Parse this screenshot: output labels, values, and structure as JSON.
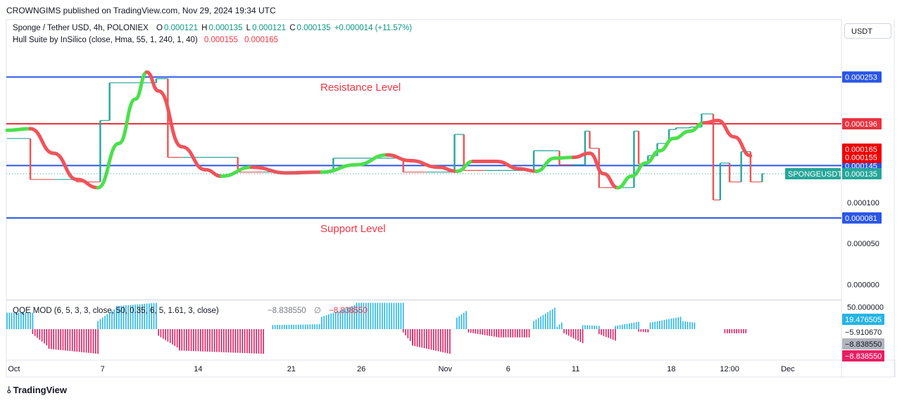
{
  "header": {
    "published": "CROWNGIMS published on TradingView.com, Nov 29, 2024 19:34 UTC"
  },
  "legend": {
    "symbol": "Sponge / Tether USD, 4h, POLONIEX",
    "o_label": "O",
    "o_value": "0.000121",
    "h_label": "H",
    "h_value": "0.000135",
    "l_label": "L",
    "l_value": "0.000121",
    "c_label": "C",
    "c_value": "0.000135",
    "change": "+0.000014 (+11.57%)",
    "hull_name": "Hull Suite by InSilico (close, Hma, 55, 1, 240, 1, 40)",
    "hull_v1": "0.000155",
    "hull_v2": "0.000165",
    "qqe_name": "QQE MOD (6, 5, 3, 3, close, 50, 0.35, 6, 5, 1.61, 3, close)",
    "qqe_v1": "−8.838550",
    "qqe_sym": "∅",
    "qqe_v2": "−8.838550"
  },
  "currency_button": "USDT",
  "annotations": {
    "resistance": "Resistance Level",
    "support": "Support Level"
  },
  "footer": {
    "brand": "TradingView"
  },
  "colors": {
    "bull_candle": "#26a69a",
    "bear_candle": "#ef5350",
    "hull_up": "#4ce04c",
    "hull_down": "#f0535a",
    "level_blue": "#2a56e6",
    "level_red": "#e8333f",
    "qqe_blue": "#26b4e6",
    "qqe_pink": "#d81b60"
  },
  "chart_data": [
    {
      "type": "candlestick",
      "title": "Sponge / Tether USD, 4h, POLONIEX",
      "x_ticks": [
        "Oct",
        "7",
        "14",
        "21",
        "26",
        "Nov",
        "6",
        "11",
        "18",
        "12:00",
        "Dec"
      ],
      "price_ticks": [
        "0.000100",
        "0.000050",
        "0.000000"
      ],
      "ylim": [
        -1e-05,
        0.000275
      ],
      "overlapped_tick_text": "0.000200",
      "last_price": "0.000135",
      "last_price_label": "SPONGEUSDT",
      "levels": [
        {
          "name": "resistance",
          "value": 0.000253,
          "label": "0.000253",
          "color": "#2a56e6"
        },
        {
          "name": "red-level",
          "value": 0.000196,
          "label": "0.000196",
          "color": "#e8333f"
        },
        {
          "name": "mid-level",
          "value": 0.000145,
          "label": "0.000145",
          "color": "#2a56e6"
        },
        {
          "name": "support",
          "value": 8.1e-05,
          "label": "0.000081",
          "color": "#2a56e6"
        }
      ],
      "price_badges": [
        {
          "label": "0.000165",
          "value": 0.000165,
          "color": "#f00000"
        },
        {
          "label": "0.000155",
          "value": 0.000155,
          "color": "#f00000"
        }
      ],
      "candles": [
        {
          "t": 0.0,
          "o": 0.000178,
          "c": 0.000178
        },
        {
          "t": 1.0,
          "o": 0.000178,
          "c": 0.000128
        },
        {
          "t": 2.0,
          "o": 0.000128,
          "c": 0.000128
        },
        {
          "t": 3.0,
          "o": 0.000128,
          "c": 0.000125
        },
        {
          "t": 4.0,
          "o": 0.000125,
          "c": 0.0002
        },
        {
          "t": 4.4,
          "o": 0.0002,
          "c": 0.000246
        },
        {
          "t": 4.9,
          "o": 0.000246,
          "c": 0.000246
        },
        {
          "t": 5.6,
          "o": 0.000246,
          "c": 0.000246
        },
        {
          "t": 6.4,
          "o": 0.000246,
          "c": 0.000251
        },
        {
          "t": 6.9,
          "o": 0.000251,
          "c": 0.000155
        },
        {
          "t": 7.5,
          "o": 0.000155,
          "c": 0.000155
        },
        {
          "t": 8.5,
          "o": 0.000155,
          "c": 0.000155
        },
        {
          "t": 9.9,
          "o": 0.000155,
          "c": 0.000137
        },
        {
          "t": 11.0,
          "o": 0.000137,
          "c": 0.000137
        },
        {
          "t": 12.5,
          "o": 0.000137,
          "c": 0.000137
        },
        {
          "t": 13.6,
          "o": 0.000137,
          "c": 0.000137
        },
        {
          "t": 14.0,
          "o": 0.000137,
          "c": 0.000154
        },
        {
          "t": 15.5,
          "o": 0.000154,
          "c": 0.000154
        },
        {
          "t": 17.0,
          "o": 0.000154,
          "c": 0.000137
        },
        {
          "t": 18.0,
          "o": 0.000137,
          "c": 0.000137
        },
        {
          "t": 19.0,
          "o": 0.000137,
          "c": 0.000137
        },
        {
          "t": 19.2,
          "o": 0.000137,
          "c": 0.000183
        },
        {
          "t": 19.6,
          "o": 0.000183,
          "c": 0.000139
        },
        {
          "t": 20.5,
          "o": 0.000139,
          "c": 0.000139
        },
        {
          "t": 22.0,
          "o": 0.000139,
          "c": 0.000139
        },
        {
          "t": 22.6,
          "o": 0.000139,
          "c": 0.000163
        },
        {
          "t": 23.4,
          "o": 0.000163,
          "c": 0.000163
        },
        {
          "t": 23.7,
          "o": 0.000163,
          "c": 0.000146
        },
        {
          "t": 24.3,
          "o": 0.000146,
          "c": 0.000146
        },
        {
          "t": 24.8,
          "o": 0.000146,
          "c": 0.000187
        },
        {
          "t": 25.0,
          "o": 0.000187,
          "c": 0.000166
        },
        {
          "t": 25.4,
          "o": 0.000166,
          "c": 0.000118
        },
        {
          "t": 26.3,
          "o": 0.000118,
          "c": 0.000118
        },
        {
          "t": 26.9,
          "o": 0.000118,
          "c": 0.000187
        },
        {
          "t": 27.1,
          "o": 0.000187,
          "c": 0.000147
        },
        {
          "t": 27.5,
          "o": 0.000147,
          "c": 0.000157
        },
        {
          "t": 27.9,
          "o": 0.000157,
          "c": 0.000172
        },
        {
          "t": 28.4,
          "o": 0.000172,
          "c": 0.000189
        },
        {
          "t": 28.7,
          "o": 0.000189,
          "c": 0.000191
        },
        {
          "t": 29.3,
          "o": 0.000191,
          "c": 0.000192
        },
        {
          "t": 29.8,
          "o": 0.000192,
          "c": 0.000208
        },
        {
          "t": 30.1,
          "o": 0.000208,
          "c": 0.000208
        },
        {
          "t": 30.3,
          "o": 0.000208,
          "c": 0.000103
        },
        {
          "t": 30.6,
          "o": 0.000103,
          "c": 0.000148
        },
        {
          "t": 31.0,
          "o": 0.000148,
          "c": 0.000125
        },
        {
          "t": 31.5,
          "o": 0.000125,
          "c": 0.000162
        },
        {
          "t": 31.9,
          "o": 0.000162,
          "c": 0.000125
        },
        {
          "t": 32.4,
          "o": 0.000125,
          "c": 0.000135
        }
      ],
      "hull": [
        [
          0.0,
          0.000188,
          "up"
        ],
        [
          1.0,
          0.00019,
          "down"
        ],
        [
          2.0,
          0.00016,
          "down"
        ],
        [
          3.0,
          0.000128,
          "down"
        ],
        [
          3.9,
          0.000118,
          "up"
        ],
        [
          4.8,
          0.000172,
          "up"
        ],
        [
          5.5,
          0.000226,
          "up"
        ],
        [
          6.0,
          0.000259,
          "down"
        ],
        [
          6.5,
          0.000236,
          "down"
        ],
        [
          7.5,
          0.000168,
          "down"
        ],
        [
          8.5,
          0.00014,
          "down"
        ],
        [
          9.2,
          0.000132,
          "up"
        ],
        [
          10.5,
          0.000143,
          "down"
        ],
        [
          12.0,
          0.000136,
          "down"
        ],
        [
          13.5,
          0.000137,
          "up"
        ],
        [
          15.0,
          0.000146,
          "up"
        ],
        [
          16.3,
          0.000158,
          "down"
        ],
        [
          17.3,
          0.000151,
          "down"
        ],
        [
          18.5,
          0.000143,
          "down"
        ],
        [
          19.3,
          0.000138,
          "up"
        ],
        [
          20.0,
          0.00015,
          "down"
        ],
        [
          21.0,
          0.00015,
          "down"
        ],
        [
          22.0,
          0.000141,
          "down"
        ],
        [
          22.7,
          0.000138,
          "up"
        ],
        [
          23.5,
          0.000154,
          "up"
        ],
        [
          24.3,
          0.000155,
          "down"
        ],
        [
          25.0,
          0.00016,
          "down"
        ],
        [
          25.6,
          0.000135,
          "down"
        ],
        [
          26.2,
          0.000118,
          "up"
        ],
        [
          26.8,
          0.000132,
          "up"
        ],
        [
          27.4,
          0.000148,
          "up"
        ],
        [
          28.0,
          0.000163,
          "up"
        ],
        [
          28.6,
          0.000178,
          "up"
        ],
        [
          29.3,
          0.000187,
          "up"
        ],
        [
          29.9,
          0.000197,
          "down"
        ],
        [
          30.5,
          0.0002,
          "down"
        ],
        [
          31.2,
          0.00018,
          "down"
        ],
        [
          31.9,
          0.000157,
          "down"
        ]
      ]
    },
    {
      "type": "histogram",
      "title": "QQE MOD (6, 5, 3, 3, close, 50, 0.35, 6, 5, 1.61, 3, close)",
      "y_ticks": [
        "50.000000"
      ],
      "value_badges": [
        {
          "label": "19.476505",
          "color": "#26b4e6"
        },
        {
          "label": "−5.910670",
          "color": "#ffffff"
        },
        {
          "label": "−8.838550",
          "color": "#b2b5be"
        },
        {
          "label": "−8.838550",
          "color": "#e91e63"
        }
      ],
      "ylim": [
        -40,
        45
      ],
      "segments": [
        {
          "t0": 0.0,
          "t1": 1.1,
          "v0": 20,
          "v1": 20,
          "color": "blue"
        },
        {
          "t0": 1.1,
          "t1": 1.8,
          "v0": -6,
          "v1": -22,
          "color": "pink"
        },
        {
          "t0": 1.8,
          "t1": 3.9,
          "v0": -24,
          "v1": -30,
          "color": "pink"
        },
        {
          "t0": 3.9,
          "t1": 4.7,
          "v0": 10,
          "v1": 26,
          "color": "blue"
        },
        {
          "t0": 4.7,
          "t1": 6.4,
          "v0": 28,
          "v1": 32,
          "color": "blue"
        },
        {
          "t0": 6.5,
          "t1": 7.4,
          "v0": -8,
          "v1": -24,
          "color": "pink"
        },
        {
          "t0": 7.4,
          "t1": 11.0,
          "v0": -26,
          "v1": -30,
          "color": "pink"
        },
        {
          "t0": 11.4,
          "t1": 13.5,
          "v0": 5,
          "v1": 6,
          "color": "blue"
        },
        {
          "t0": 13.5,
          "t1": 15.0,
          "v0": 15,
          "v1": 30,
          "color": "blue"
        },
        {
          "t0": 15.0,
          "t1": 17.0,
          "v0": 32,
          "v1": 32,
          "color": "blue"
        },
        {
          "t0": 17.0,
          "t1": 17.4,
          "v0": -4,
          "v1": -18,
          "color": "pink"
        },
        {
          "t0": 17.4,
          "t1": 19.0,
          "v0": -20,
          "v1": -30,
          "color": "pink"
        },
        {
          "t0": 19.3,
          "t1": 19.7,
          "v0": 14,
          "v1": 22,
          "color": "blue"
        },
        {
          "t0": 19.8,
          "t1": 21.1,
          "v0": -4,
          "v1": -10,
          "color": "pink"
        },
        {
          "t0": 21.1,
          "t1": 22.4,
          "v0": -10,
          "v1": -10,
          "color": "pink"
        },
        {
          "t0": 22.6,
          "t1": 23.5,
          "v0": 10,
          "v1": 26,
          "color": "blue"
        },
        {
          "t0": 23.6,
          "t1": 23.8,
          "v0": 3,
          "v1": 8,
          "color": "blue"
        },
        {
          "t0": 23.9,
          "t1": 24.7,
          "v0": -5,
          "v1": -17,
          "color": "pink"
        },
        {
          "t0": 24.7,
          "t1": 25.4,
          "v0": 5,
          "v1": 4,
          "color": "blue"
        },
        {
          "t0": 25.4,
          "t1": 26.1,
          "v0": -6,
          "v1": -14,
          "color": "pink"
        },
        {
          "t0": 26.1,
          "t1": 27.1,
          "v0": 4,
          "v1": 9,
          "color": "blue"
        },
        {
          "t0": 27.1,
          "t1": 27.5,
          "v0": -3,
          "v1": -4,
          "color": "pink"
        },
        {
          "t0": 27.6,
          "t1": 28.9,
          "v0": 8,
          "v1": 15,
          "color": "blue"
        },
        {
          "t0": 28.9,
          "t1": 29.5,
          "v0": 10,
          "v1": 8,
          "color": "blue"
        },
        {
          "t0": 30.8,
          "t1": 31.7,
          "v0": -5,
          "v1": -5,
          "color": "pink"
        }
      ]
    }
  ]
}
